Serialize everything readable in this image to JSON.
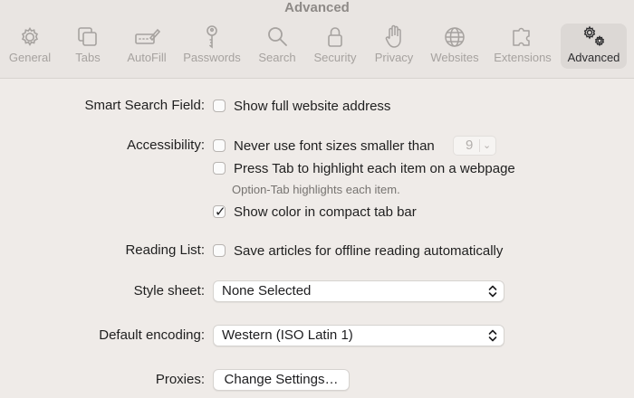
{
  "window": {
    "title": "Advanced"
  },
  "toolbar": {
    "items": [
      {
        "label": "General",
        "icon": "gear-icon"
      },
      {
        "label": "Tabs",
        "icon": "tabs-icon"
      },
      {
        "label": "AutoFill",
        "icon": "autofill-icon"
      },
      {
        "label": "Passwords",
        "icon": "key-icon"
      },
      {
        "label": "Search",
        "icon": "search-icon"
      },
      {
        "label": "Security",
        "icon": "lock-icon"
      },
      {
        "label": "Privacy",
        "icon": "hand-icon"
      },
      {
        "label": "Websites",
        "icon": "globe-icon"
      },
      {
        "label": "Extensions",
        "icon": "puzzle-icon"
      },
      {
        "label": "Advanced",
        "icon": "gears-icon",
        "selected": true
      }
    ]
  },
  "settings": {
    "smart_search": {
      "label": "Smart Search Field:",
      "show_full_address": {
        "label": "Show full website address",
        "checked": false
      }
    },
    "accessibility": {
      "label": "Accessibility:",
      "min_font": {
        "label": "Never use font sizes smaller than",
        "checked": false,
        "value": "9"
      },
      "tab_highlight": {
        "label": "Press Tab to highlight each item on a webpage",
        "checked": false
      },
      "tab_note": "Option-Tab highlights each item.",
      "compact_color": {
        "label": "Show color in compact tab bar",
        "checked": true
      }
    },
    "reading_list": {
      "label": "Reading List:",
      "offline": {
        "label": "Save articles for offline reading automatically",
        "checked": false
      }
    },
    "style_sheet": {
      "label": "Style sheet:",
      "value": "None Selected"
    },
    "encoding": {
      "label": "Default encoding:",
      "value": "Western (ISO Latin 1)"
    },
    "proxies": {
      "label": "Proxies:",
      "button": "Change Settings…"
    }
  }
}
